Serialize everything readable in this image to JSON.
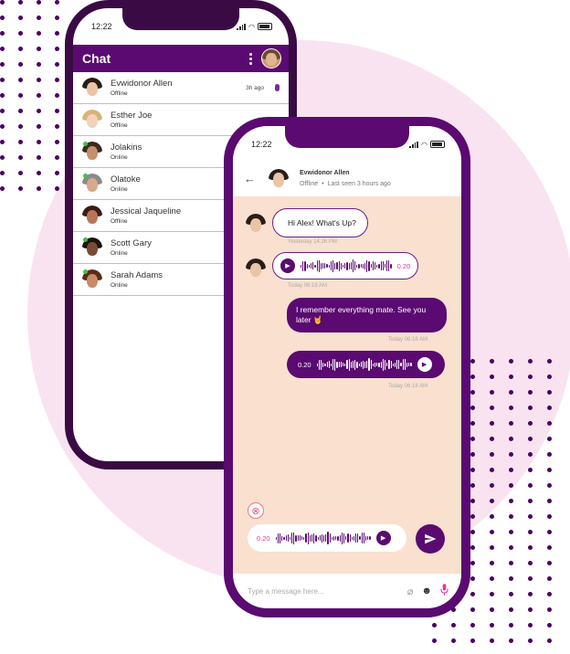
{
  "back_phone": {
    "status_time": "12:22",
    "header_title": "Chat",
    "contacts": [
      {
        "name": "Evwidonor Allen",
        "status": "Offline",
        "time": "3h ago",
        "has_mic": true,
        "online_dot": false,
        "hair": "#2a1d18",
        "skin": "#e9c4a5"
      },
      {
        "name": "Esther  Joe",
        "status": "Offline",
        "time": "",
        "has_mic": false,
        "online_dot": false,
        "hair": "#d9b27b",
        "skin": "#f1d3bd"
      },
      {
        "name": "Jolakins",
        "status": "Online",
        "time": "",
        "has_mic": false,
        "online_dot": true,
        "hair": "#3a2a22",
        "skin": "#c68e6a"
      },
      {
        "name": "Olatoke",
        "status": "Online",
        "time": "",
        "has_mic": false,
        "online_dot": true,
        "hair": "#8a8a8a",
        "skin": "#d7a88a"
      },
      {
        "name": "Jessical Jaqueline",
        "status": "Offline",
        "time": "",
        "has_mic": false,
        "online_dot": false,
        "hair": "#3b1c12",
        "skin": "#b8755a"
      },
      {
        "name": "Scott Gary",
        "status": "Online",
        "time": "",
        "has_mic": false,
        "online_dot": true,
        "hair": "#1c120c",
        "skin": "#7a4a32"
      },
      {
        "name": "Sarah Adams",
        "status": "Online",
        "time": "",
        "has_mic": false,
        "online_dot": true,
        "hair": "#5a2a18",
        "skin": "#c88a68"
      }
    ]
  },
  "front_phone": {
    "status_time": "12:22",
    "contact_name": "Evwidonor Allen",
    "contact_status": "Offline",
    "last_seen": "Last seen 3 hours ago",
    "messages": {
      "m1_text": "Hi Alex! What's Up?",
      "m1_time": "Yesterday 14:26 PM",
      "m2_duration": "0.20",
      "m2_time": "Today 06:18 AM",
      "m3_text": "I remember everything mate. See you later 🤘",
      "m3_time": "Today 06:18 AM",
      "m4_duration": "0.20",
      "m4_time": "Today 06:18 AM"
    },
    "recorder_duration": "0.20",
    "input_placeholder": "Type a message here...",
    "icons": {
      "back": "arrow-left-icon",
      "cancel": "close-circle-icon",
      "send": "send-icon",
      "attach": "paperclip-icon",
      "emoji": "emoji-icon",
      "mic": "microphone-icon"
    }
  },
  "colors": {
    "brand_purple": "#5a0a70",
    "chat_background": "#f9e0cf",
    "background_blob": "#f9e3f1",
    "accent_pink": "#e0399a"
  }
}
